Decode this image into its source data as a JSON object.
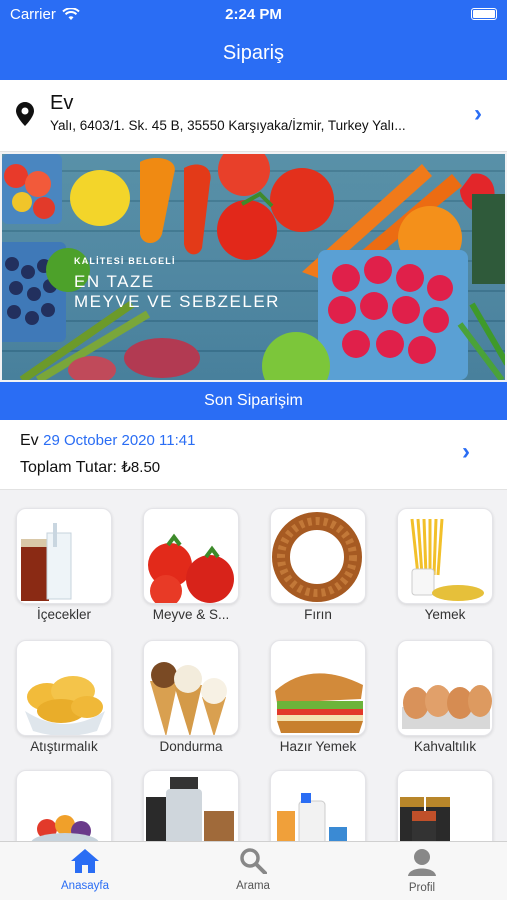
{
  "status_bar": {
    "carrier": "Carrier",
    "time": "2:24 PM"
  },
  "nav": {
    "title": "Sipariş"
  },
  "address": {
    "title": "Ev",
    "text": "Yalı, 6403/1. Sk. 45 B, 35550 Karşıyaka/İzmir, Turkey Yalı..."
  },
  "banner": {
    "badge": "KALİTESİ BELGELİ",
    "line1": "EN TAZE",
    "line2": "MEYVE VE SEBZELER"
  },
  "last_order": {
    "header": "Son Siparişim",
    "name": "Ev",
    "date": "29 October 2020 11:41",
    "total_label": "Toplam Tutar:",
    "total_value": "₺8.50"
  },
  "categories": [
    {
      "label": "İçecekler",
      "icon": "drinks"
    },
    {
      "label": "Meyve & S...",
      "icon": "tomatoes"
    },
    {
      "label": "Fırın",
      "icon": "simit"
    },
    {
      "label": "Yemek",
      "icon": "pasta"
    },
    {
      "label": "Atıştırmalık",
      "icon": "chips"
    },
    {
      "label": "Dondurma",
      "icon": "ice-cream"
    },
    {
      "label": "Hazır Yemek",
      "icon": "sandwich"
    },
    {
      "label": "Kahvaltılık",
      "icon": "eggs"
    },
    {
      "label": "",
      "icon": "fruit-bowl"
    },
    {
      "label": "",
      "icon": "bottles"
    },
    {
      "label": "",
      "icon": "cleaning"
    },
    {
      "label": "",
      "icon": "batteries"
    }
  ],
  "tabs": [
    {
      "label": "Anasayfa",
      "icon": "home-icon",
      "active": true
    },
    {
      "label": "Arama",
      "icon": "search-icon",
      "active": false
    },
    {
      "label": "Profil",
      "icon": "profile-icon",
      "active": false
    }
  ],
  "colors": {
    "accent": "#2a6df4"
  }
}
